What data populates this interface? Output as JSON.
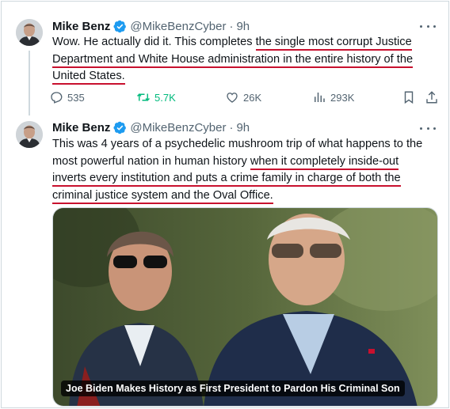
{
  "tweets": [
    {
      "author": {
        "name": "Mike Benz",
        "handle": "@MikeBenzCyber",
        "time": "9h"
      },
      "text": {
        "plain": "Wow. He actually did it. This completes ",
        "highlight_1": "the single most corrupt Justice",
        "highlight_2": "Department and White House administration in the entire history of the",
        "highlight_3": "United States."
      },
      "stats": {
        "replies": "535",
        "reposts": "5.7K",
        "likes": "26K",
        "views": "293K"
      }
    },
    {
      "author": {
        "name": "Mike Benz",
        "handle": "@MikeBenzCyber",
        "time": "9h"
      },
      "text": {
        "line_1": "This was 4 years of a psychedelic mushroom trip of what happens to the",
        "line_2_plain": "most powerful nation in human history ",
        "line_2_highlight": "when it completely inside-out",
        "line_3": "inverts every institution and puts a crime family in charge of both the",
        "line_4": "criminal justice system and the Oval Office."
      },
      "media": {
        "caption": "Joe Biden Makes History as First President to Pardon His Criminal Son"
      }
    }
  ],
  "icons": {
    "verified": "verified-badge-icon",
    "more": "more-options-icon",
    "reply": "reply-icon",
    "repost": "repost-icon",
    "like": "like-icon",
    "views": "views-icon",
    "bookmark": "bookmark-icon",
    "share": "share-icon"
  },
  "colors": {
    "verified": "#1d9bf0",
    "repost_active": "#00ba7c",
    "annotation_underline": "#c8102e",
    "secondary_text": "#536471"
  }
}
